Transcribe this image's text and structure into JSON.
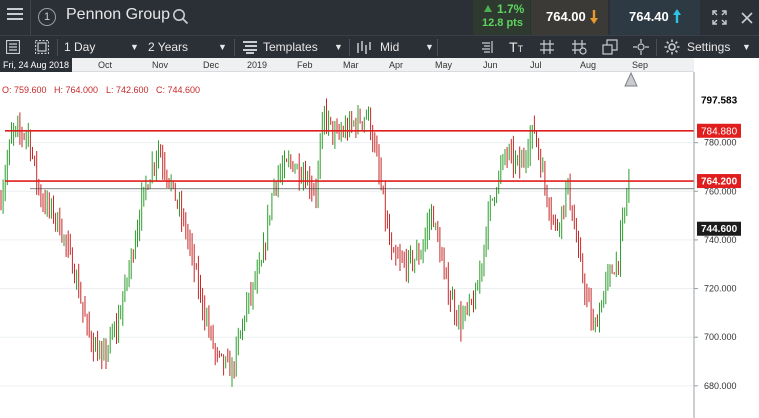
{
  "header": {
    "instrument_number": "1",
    "title": "Pennon Group",
    "change_pct": "1.7%",
    "change_pts": "12.8 pts",
    "sell_price": "764.00",
    "buy_price": "764.40"
  },
  "toolbar": {
    "interval": "1 Day",
    "range": "2 Years",
    "templates": "Templates",
    "price_type": "Mid",
    "text_tool": "T",
    "settings": "Settings"
  },
  "ohlc": {
    "open": "O: 759.600",
    "high": "H: 764.000",
    "low": "L: 742.600",
    "close": "C: 744.600"
  },
  "crosshair_date": "Fri, 24 Aug 2018",
  "colors": {
    "up": "#2e9e2e",
    "down": "#c62828",
    "line": "#e01e1e",
    "toolbar": "#2b2f36",
    "accent_up": "#4caf50"
  },
  "chart_data": {
    "type": "ohlc",
    "x_ticks": [
      "Oct",
      "Nov",
      "Dec",
      "2019",
      "Feb",
      "Mar",
      "Apr",
      "May",
      "Jun",
      "Jul",
      "Aug",
      "Sep"
    ],
    "y_ticks": [
      "780.000",
      "760.000",
      "740.000",
      "720.000",
      "700.000",
      "680.000"
    ],
    "ylim": [
      675,
      800
    ],
    "price_labels": [
      "797.583",
      "784.880",
      "764.200",
      "744.600"
    ],
    "horizontal_lines": [
      784.88,
      764.2
    ],
    "last_close": 744.6,
    "series_path": [
      [
        0,
        755
      ],
      [
        12,
        784
      ],
      [
        28,
        784
      ],
      [
        40,
        758
      ],
      [
        58,
        748
      ],
      [
        74,
        728
      ],
      [
        88,
        702
      ],
      [
        102,
        690
      ],
      [
        118,
        706
      ],
      [
        130,
        730
      ],
      [
        142,
        756
      ],
      [
        158,
        778
      ],
      [
        170,
        764
      ],
      [
        186,
        744
      ],
      [
        200,
        718
      ],
      [
        216,
        692
      ],
      [
        232,
        686
      ],
      [
        246,
        712
      ],
      [
        262,
        730
      ],
      [
        274,
        764
      ],
      [
        290,
        772
      ],
      [
        302,
        768
      ],
      [
        316,
        760
      ],
      [
        324,
        792
      ],
      [
        336,
        782
      ],
      [
        348,
        786
      ],
      [
        368,
        792
      ],
      [
        378,
        770
      ],
      [
        392,
        732
      ],
      [
        406,
        730
      ],
      [
        420,
        734
      ],
      [
        432,
        752
      ],
      [
        446,
        722
      ],
      [
        460,
        706
      ],
      [
        476,
        716
      ],
      [
        490,
        754
      ],
      [
        506,
        776
      ],
      [
        520,
        770
      ],
      [
        534,
        786
      ],
      [
        546,
        760
      ],
      [
        556,
        744
      ],
      [
        568,
        762
      ],
      [
        580,
        730
      ],
      [
        594,
        702
      ],
      [
        606,
        722
      ],
      [
        618,
        732
      ],
      [
        630,
        768
      ]
    ]
  }
}
